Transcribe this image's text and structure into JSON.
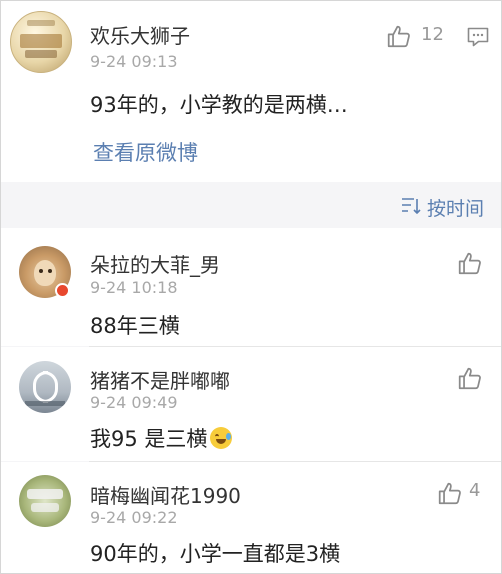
{
  "main_comment": {
    "user_name": "欢乐大狮子",
    "time": "9-24 09:13",
    "text": "93年的，小学教的是两横…",
    "like_count": "12",
    "view_original_label": "查看原微博"
  },
  "sort": {
    "label": "按时间"
  },
  "replies": [
    {
      "user_name": "朵拉的大菲_男",
      "time": "9-24 10:18",
      "text": "88年三横",
      "like_count": ""
    },
    {
      "user_name": "猪猪不是胖嘟嘟",
      "time": "9-24 09:49",
      "text": "我95 是三横",
      "emoji": "laughing-crying",
      "like_count": ""
    },
    {
      "user_name": "暗梅幽闻花1990",
      "time": "9-24 09:22",
      "text": "90年的，小学一直都是3横",
      "like_count": "4"
    }
  ],
  "colors": {
    "link_blue": "#5b7fb1",
    "text": "#222222",
    "secondary": "#a8a8a8",
    "background": "#f5f5f7",
    "badge_red": "#e8482e"
  }
}
